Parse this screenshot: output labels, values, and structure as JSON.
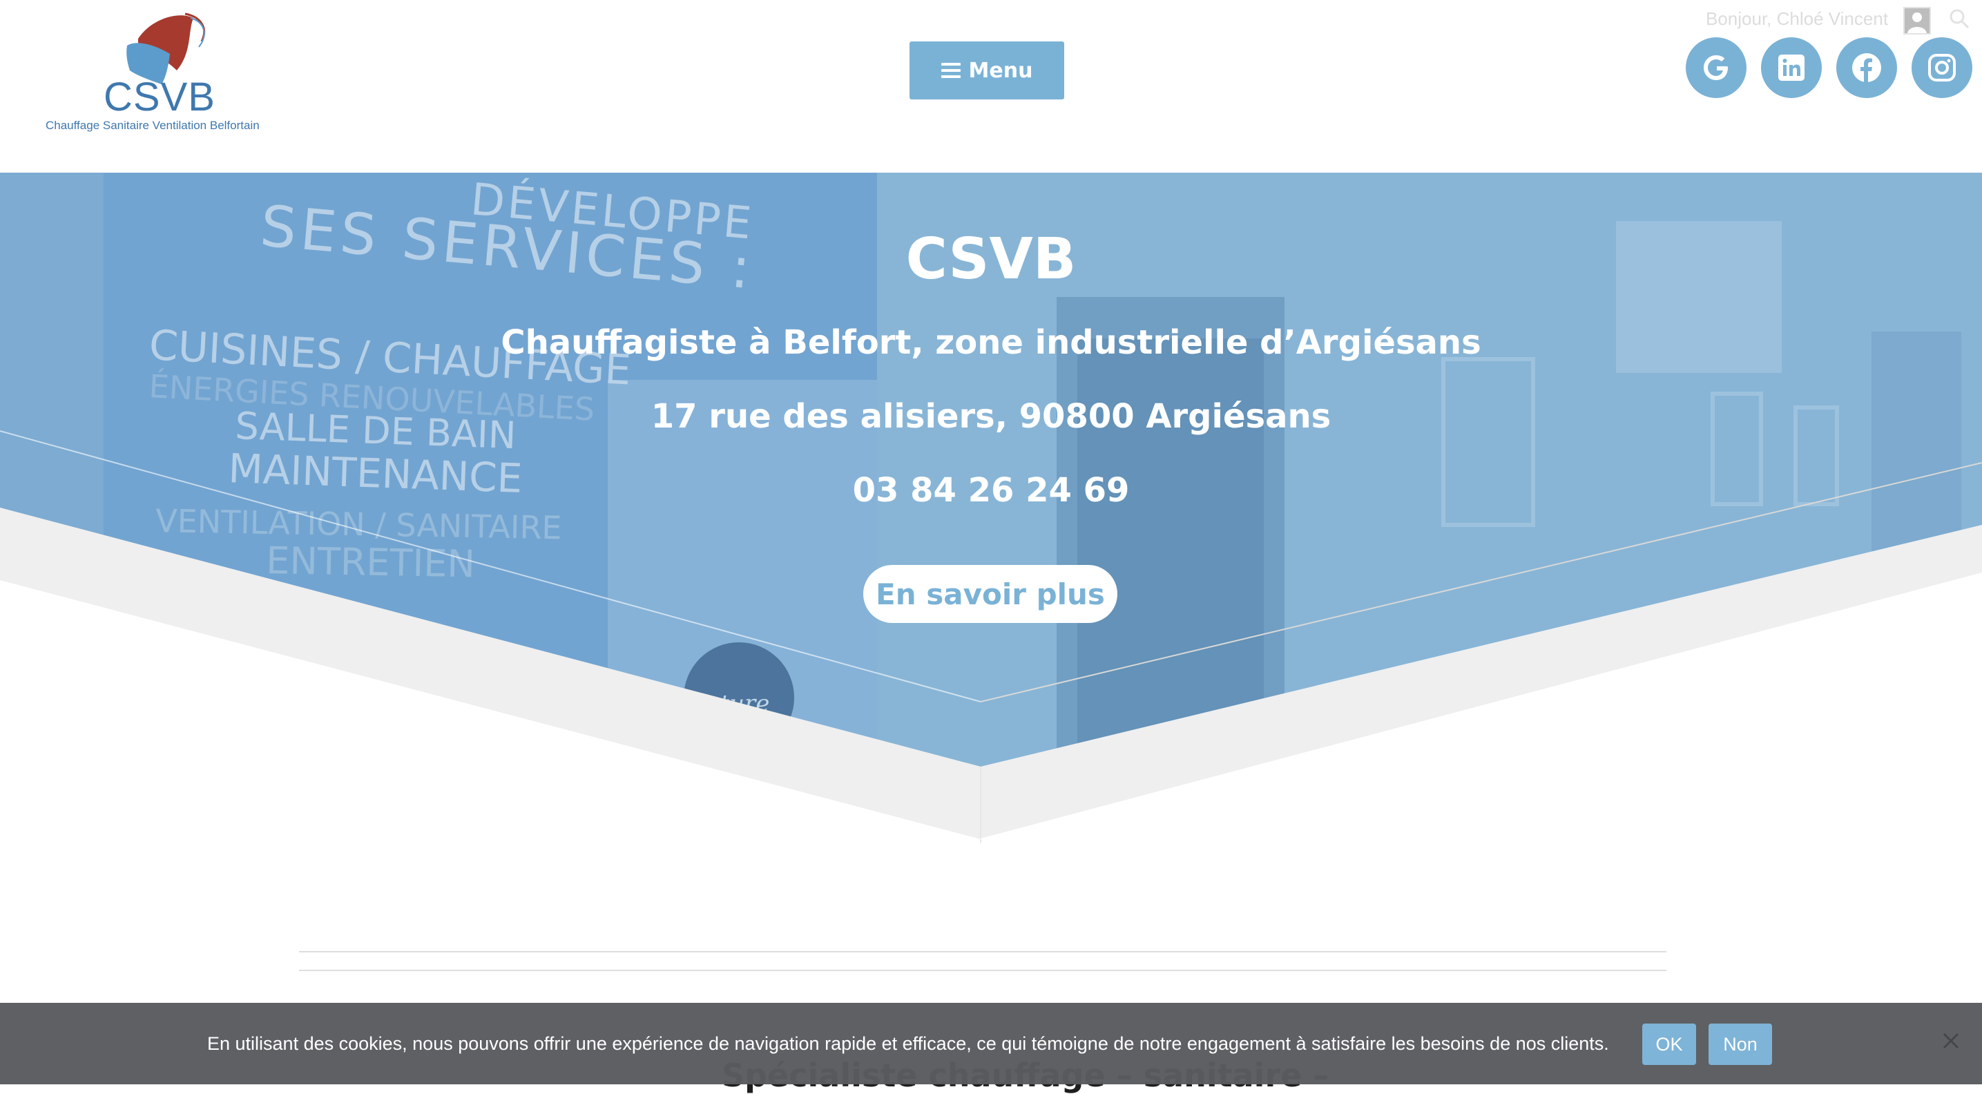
{
  "header": {
    "logo": {
      "brand": "CSVB",
      "tagline": "Chauffage Sanitaire Ventilation Belfortain"
    },
    "menu_label": "Menu",
    "greeting": "Bonjour, Chloé Vincent",
    "social": [
      "google-icon",
      "linkedin-icon",
      "facebook-icon",
      "instagram-icon"
    ]
  },
  "hero": {
    "title": "CSVB",
    "subtitle": "Chauffagiste à Belfort, zone industrielle d’Argiésans",
    "address": "17 rue des alisiers, 90800 Argiésans",
    "phone": "03 84 26 24 69",
    "cta_label": "En savoir plus",
    "background_sign": {
      "line1": "DÉVELOPPE",
      "line2": "SES  SERVICES :",
      "items": [
        "CUISINES / CHAUFFAGE",
        "ÉNERGIES RENOUVELABLES",
        "SALLE DE BAIN",
        "MAINTENANCE",
        "VENTILATION / SANITAIRE",
        "ENTRETIEN"
      ]
    }
  },
  "section": {
    "heading_partial": "Spécialiste chauffage – sanitaire –"
  },
  "cookie": {
    "message": "En utilisant des cookies, nous pouvons offrir une expérience de navigation rapide et efficace, ce qui témoigne de notre engagement à satisfaire les besoins de nos clients.",
    "ok_label": "OK",
    "no_label": "Non"
  },
  "colors": {
    "accent": "#7ab2d6",
    "brand_blue": "#3f78ae",
    "brand_red": "#a63a2e",
    "cookie_bg": "#595b5f"
  }
}
